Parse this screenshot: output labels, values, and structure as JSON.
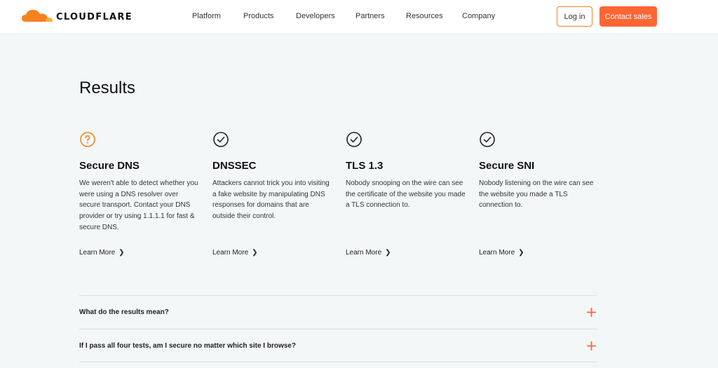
{
  "header": {
    "logo_text": "CLOUDFLARE",
    "nav": [
      "Platform",
      "Products",
      "Developers",
      "Partners",
      "Resources",
      "Company"
    ],
    "login_label": "Log in",
    "contact_label": "Contact sales"
  },
  "main": {
    "title": "Results",
    "cards": [
      {
        "icon": "question-circle-icon",
        "status": "unknown",
        "title": "Secure DNS",
        "description": "We weren't able to detect whether you were using a DNS resolver over secure transport. Contact your DNS provider or try using 1.1.1.1 for fast & secure DNS.",
        "learn_more": "Learn More"
      },
      {
        "icon": "check-circle-icon",
        "status": "pass",
        "title": "DNSSEC",
        "description": "Attackers cannot trick you into visiting a fake website by manipulating DNS responses for domains that are outside their control.",
        "learn_more": "Learn More"
      },
      {
        "icon": "check-circle-icon",
        "status": "pass",
        "title": "TLS 1.3",
        "description": "Nobody snooping on the wire can see the certificate of the website you made a TLS connection to.",
        "learn_more": "Learn More"
      },
      {
        "icon": "check-circle-icon",
        "status": "pass",
        "title": "Secure SNI",
        "description": "Nobody listening on the wire can see the website you made a TLS connection to.",
        "learn_more": "Learn More"
      }
    ]
  },
  "faq": [
    {
      "question": "What do the results mean?"
    },
    {
      "question": "If I pass all four tests, am I secure no matter which site I browse?"
    }
  ],
  "colors": {
    "brand_orange": "#f6821f",
    "cta_orange": "#ff6633",
    "background": "#f4f7f8"
  }
}
